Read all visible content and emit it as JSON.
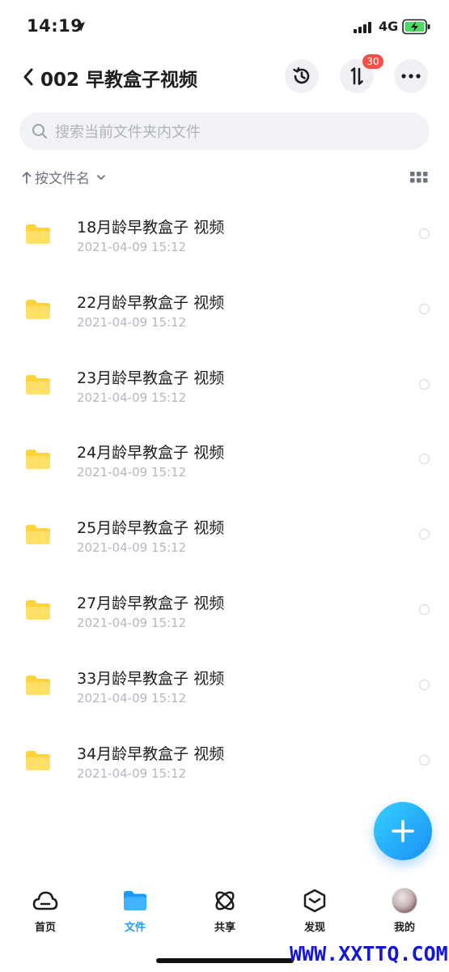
{
  "status_bar": {
    "time": "14:19",
    "network": "4G"
  },
  "nav": {
    "title": "002 早教盒子视频",
    "transfer_badge": "30"
  },
  "search": {
    "placeholder": "搜索当前文件夹内文件"
  },
  "sort": {
    "label": "按文件名"
  },
  "files": [
    {
      "name": "18月龄早教盒子 视频",
      "date": "2021-04-09 15:12"
    },
    {
      "name": "22月龄早教盒子 视频",
      "date": "2021-04-09 15:12"
    },
    {
      "name": "23月龄早教盒子 视频",
      "date": "2021-04-09 15:12"
    },
    {
      "name": "24月龄早教盒子 视频",
      "date": "2021-04-09 15:12"
    },
    {
      "name": "25月龄早教盒子 视频",
      "date": "2021-04-09 15:12"
    },
    {
      "name": "27月龄早教盒子 视频",
      "date": "2021-04-09 15:12"
    },
    {
      "name": "33月龄早教盒子 视频",
      "date": "2021-04-09 15:12"
    },
    {
      "name": "34月龄早教盒子 视频",
      "date": "2021-04-09 15:12"
    }
  ],
  "tabs": [
    {
      "label": "首页",
      "icon": "cloud-icon"
    },
    {
      "label": "文件",
      "icon": "folder-icon",
      "active": true
    },
    {
      "label": "共享",
      "icon": "atom-icon"
    },
    {
      "label": "发现",
      "icon": "cube-icon"
    },
    {
      "label": "我的",
      "icon": "avatar"
    }
  ],
  "watermark": "WWW.XXTTQ.COM",
  "colors": {
    "accent": "#1a9cf5",
    "folder": "#ffd43b",
    "badge": "#f2514a"
  }
}
